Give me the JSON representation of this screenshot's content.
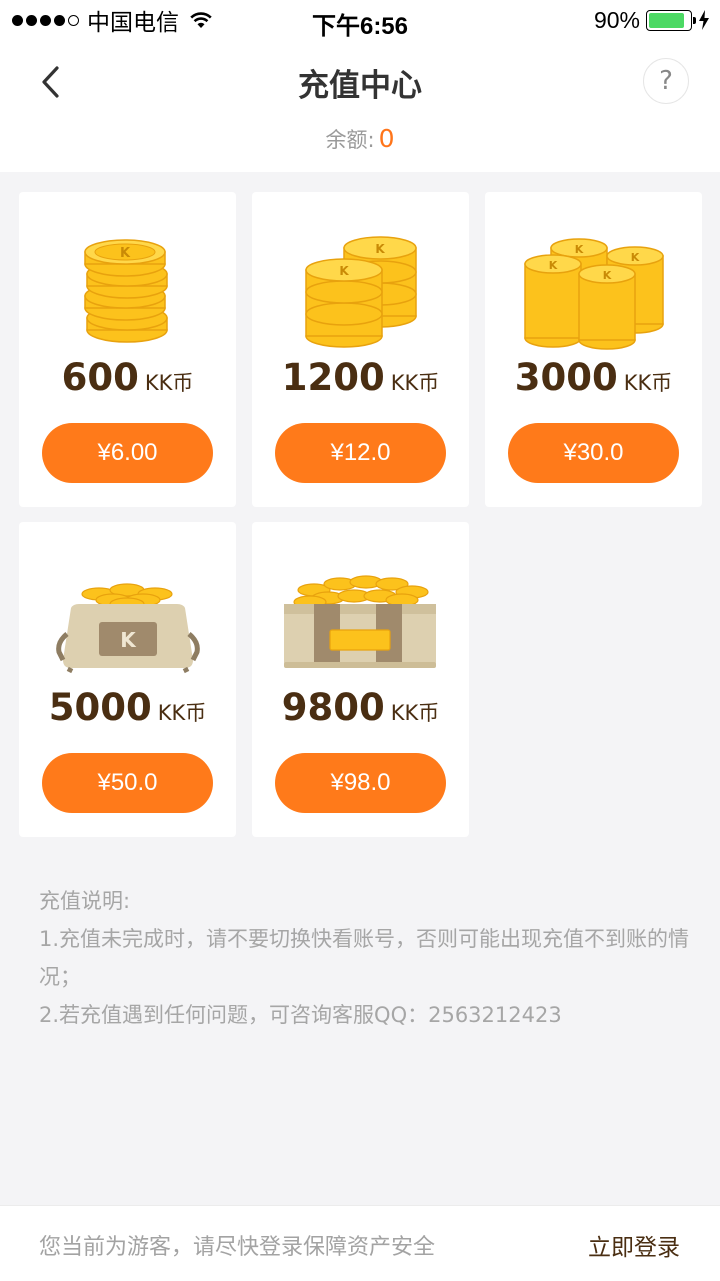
{
  "status_bar": {
    "carrier": "中国电信",
    "time": "下午6:56",
    "battery_percent": "90%",
    "battery_level": 0.9,
    "signal_bars": 4
  },
  "header": {
    "title": "充值中心",
    "help_label": "?",
    "balance_label": "余额:",
    "balance_value": "0"
  },
  "packages": [
    {
      "amount": "600",
      "unit": "KK币",
      "price": "¥6.00",
      "art": "coin-stack-icon"
    },
    {
      "amount": "1200",
      "unit": "KK币",
      "price": "¥12.0",
      "art": "two-coin-stacks-icon"
    },
    {
      "amount": "3000",
      "unit": "KK币",
      "price": "¥30.0",
      "art": "three-coin-stacks-icon"
    },
    {
      "amount": "5000",
      "unit": "KK币",
      "price": "¥50.0",
      "art": "coin-bag-icon"
    },
    {
      "amount": "9800",
      "unit": "KK币",
      "price": "¥98.0",
      "art": "coin-chest-icon"
    }
  ],
  "notes": {
    "title": "充值说明:",
    "items": [
      "1.充值未完成时，请不要切换快看账号，否则可能出现充值不到账的情况；",
      "2.若充值遇到任何问题，可咨询客服QQ：2563212423"
    ]
  },
  "footer": {
    "guest_text": "您当前为游客，请尽快登录保障资产安全",
    "login_label": "立即登录"
  },
  "colors": {
    "accent": "#ff7a1a",
    "balance": "#ff751a",
    "amount_text": "#4a2e12",
    "background": "#f4f4f6"
  }
}
